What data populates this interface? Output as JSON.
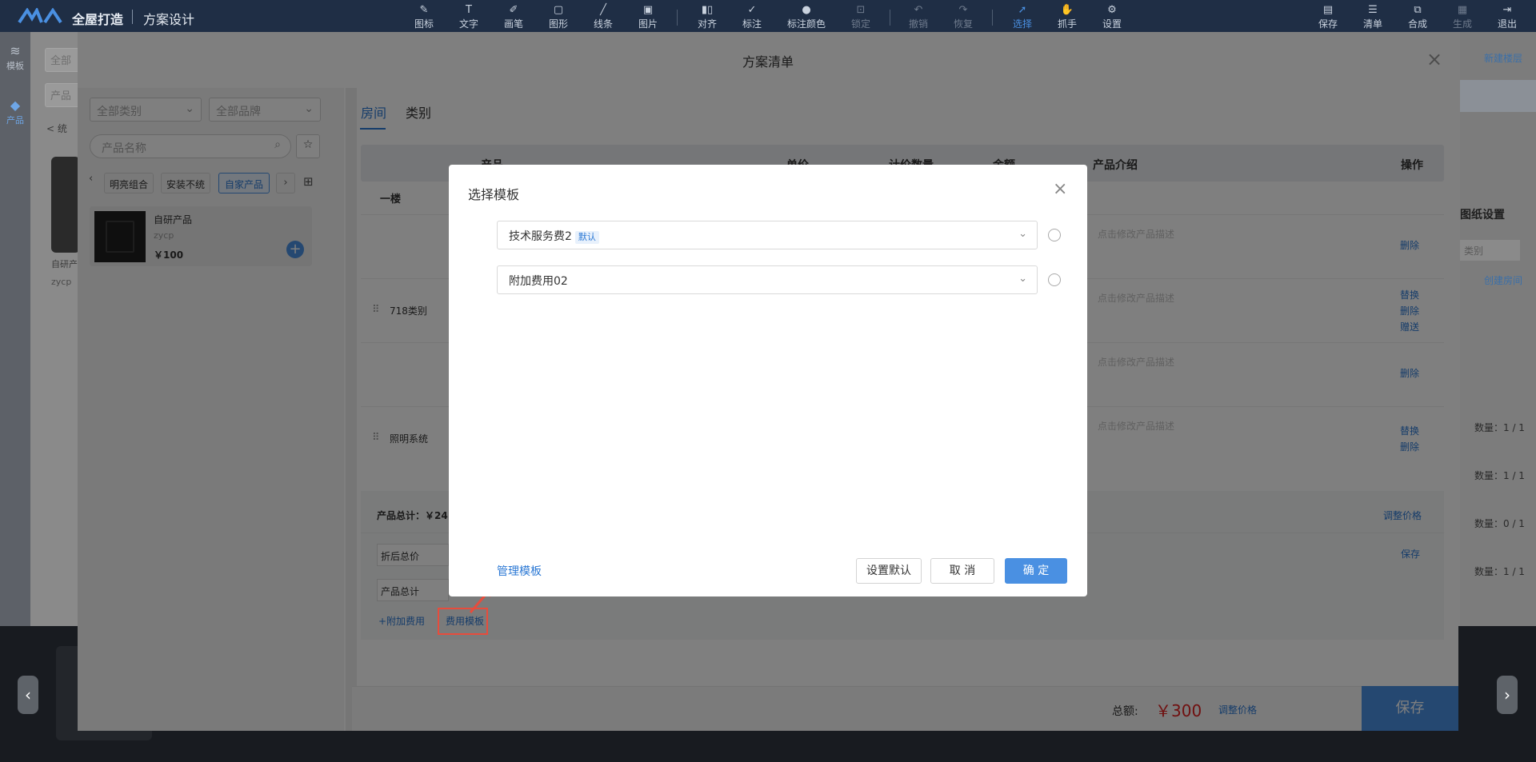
{
  "app": {
    "title": "全屋打造",
    "subtitle": "方案设计"
  },
  "toolbar": {
    "tools": [
      {
        "icon": "icon-tool-icon",
        "label": "图标"
      },
      {
        "icon": "text-tool-icon",
        "label": "文字"
      },
      {
        "icon": "brush-tool-icon",
        "label": "画笔"
      },
      {
        "icon": "shape-tool-icon",
        "label": "图形"
      },
      {
        "icon": "line-tool-icon",
        "label": "线条"
      },
      {
        "icon": "image-tool-icon",
        "label": "图片"
      },
      {
        "icon": "align-tool-icon",
        "label": "对齐"
      },
      {
        "icon": "mark-tool-icon",
        "label": "标注"
      },
      {
        "icon": "mark-color-tool-icon",
        "label": "标注颜色"
      },
      {
        "icon": "lock-tool-icon",
        "label": "锁定"
      },
      {
        "icon": "undo-tool-icon",
        "label": "撤销"
      },
      {
        "icon": "redo-tool-icon",
        "label": "恢复"
      },
      {
        "icon": "select-tool-icon",
        "label": "选择"
      },
      {
        "icon": "hand-tool-icon",
        "label": "抓手"
      },
      {
        "icon": "settings-tool-icon",
        "label": "设置"
      }
    ],
    "right": [
      {
        "icon": "save-icon",
        "label": "保存"
      },
      {
        "icon": "list-icon",
        "label": "清单"
      },
      {
        "icon": "merge-icon",
        "label": "合成"
      },
      {
        "icon": "generate-icon",
        "label": "生成"
      },
      {
        "icon": "exit-icon",
        "label": "退出"
      }
    ]
  },
  "rail": {
    "items": [
      {
        "label": "模板"
      },
      {
        "label": "产品"
      }
    ]
  },
  "background": {
    "left_input1": "全部",
    "left_input2": "产品",
    "left_crumb": "< 统",
    "card_label": "自研产",
    "card_sub": "zycp",
    "right_new_layer": "新建楼层",
    "right_drawing_settings": "图纸设置",
    "right_category": "类别",
    "right_create_room": "创建房间",
    "right_qty": [
      "数量：1 / 1",
      "数量：1 / 1",
      "数量：0 / 1",
      "数量：1 / 1"
    ]
  },
  "modal": {
    "title": "方案清单",
    "left": {
      "category_select": "全部类别",
      "brand_select": "全部品牌",
      "search_placeholder": "产品名称",
      "chips": [
        "明亮组合",
        "安装不统",
        "自家产品"
      ],
      "product": {
        "name": "自研产品",
        "code": "zycp",
        "price": "￥100"
      }
    },
    "tabs": [
      "房间",
      "类别"
    ],
    "table_headers": [
      "产品",
      "单价",
      "计价数量",
      "金额",
      "产品介绍",
      "操作"
    ],
    "floor_label": "一楼",
    "groups": [
      "718类别",
      "照明系统"
    ],
    "desc_placeholder": "点击修改产品描述",
    "actions": {
      "delete": "删除",
      "replace": "替换",
      "gift": "赠送"
    },
    "summary": {
      "product_total": "产品总计：￥24",
      "adjust_price": "调整价格",
      "save": "保存",
      "discount_total": "折后总价",
      "product_total_field": "产品总计",
      "add_fee": "+附加费用",
      "fee_template": "费用模板"
    },
    "footer": {
      "total_label": "总额:",
      "total_value": "￥300",
      "adjust_price": "调整价格",
      "save": "保存"
    }
  },
  "dialog": {
    "title": "选择模板",
    "templates": [
      {
        "name": "技术服务费2",
        "badge": "默认"
      },
      {
        "name": "附加费用02",
        "badge": ""
      }
    ],
    "manage_link": "管理模板",
    "buttons": {
      "set_default": "设置默认",
      "cancel": "取 消",
      "confirm": "确 定"
    }
  },
  "colors": {
    "accent": "#4a90e2",
    "price_red": "#e02020",
    "highlight": "#e74c3c"
  }
}
